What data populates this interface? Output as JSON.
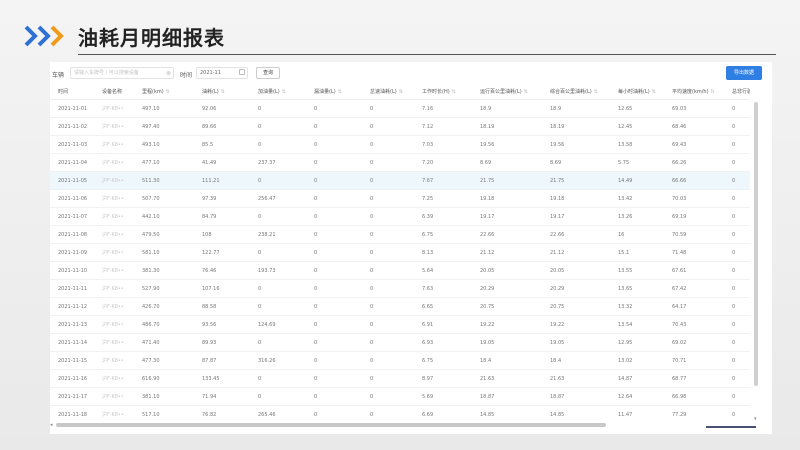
{
  "page": {
    "title": "油耗月明细报表"
  },
  "toolbar": {
    "vehicle_label": "车辆",
    "vehicle_placeholder": "请输入车牌号 / 可以搜索设备",
    "time_label": "时间",
    "time_value": "2021-11",
    "query_label": "查询",
    "export_label": "导出数据"
  },
  "colors": {
    "accent": "#2f7ee3",
    "chevron_blue": "#2f6fd6",
    "chevron_orange": "#f29a1b",
    "row_highlight": "#eef7fb"
  },
  "icons": {
    "sort": "sort-icon",
    "calendar": "calendar-icon",
    "clear": "clear-icon",
    "chevrons": "chevron-right-icon"
  },
  "table": {
    "headers": [
      "时间",
      "设备名称",
      "里程(km)",
      "油耗(L)",
      "加油量(L)",
      "漏油量(L)",
      "怠速油耗(L)",
      "工作时长(H)",
      "运行百公里油耗(L)",
      "综合百公里油耗(L)",
      "每小时油耗(L)",
      "平均速度(km/h)",
      "总非行驶油"
    ],
    "sortable": [
      false,
      false,
      true,
      true,
      true,
      true,
      true,
      true,
      true,
      true,
      true,
      true,
      false
    ],
    "rows": [
      [
        "2021-11-01",
        "沪F·K8••",
        "497.10",
        "92.06",
        "0",
        "0",
        "0",
        "7.16",
        "18.9",
        "18.9",
        "12.65",
        "69.03",
        "0"
      ],
      [
        "2021-11-02",
        "沪F·K8••",
        "497.40",
        "89.66",
        "0",
        "0",
        "0",
        "7.12",
        "18.19",
        "18.19",
        "12.45",
        "68.46",
        "0"
      ],
      [
        "2021-11-03",
        "沪F·K8••",
        "493.10",
        "85.5",
        "0",
        "0",
        "0",
        "7.03",
        "19.56",
        "19.56",
        "13.58",
        "69.43",
        "0"
      ],
      [
        "2021-11-04",
        "沪F·K8••",
        "477.10",
        "41.49",
        "237.37",
        "0",
        "0",
        "7.20",
        "8.69",
        "8.69",
        "5.75",
        "66.26",
        "0"
      ],
      [
        "2021-11-05",
        "沪F·K8••",
        "511.30",
        "111.21",
        "0",
        "0",
        "0",
        "7.67",
        "21.75",
        "21.75",
        "14.49",
        "66.66",
        "0"
      ],
      [
        "2021-11-06",
        "沪F·K8••",
        "507.70",
        "97.39",
        "256.47",
        "0",
        "0",
        "7.25",
        "19.18",
        "19.18",
        "13.42",
        "70.03",
        "0"
      ],
      [
        "2021-11-07",
        "沪F·K8••",
        "442.10",
        "84.79",
        "0",
        "0",
        "0",
        "6.39",
        "19.17",
        "19.17",
        "13.26",
        "69.19",
        "0"
      ],
      [
        "2021-11-08",
        "沪F·K8••",
        "479.50",
        "108",
        "238.21",
        "0",
        "0",
        "6.75",
        "22.66",
        "22.66",
        "16",
        "70.59",
        "0"
      ],
      [
        "2021-11-09",
        "沪F·K8••",
        "581.10",
        "122.77",
        "0",
        "0",
        "0",
        "8.13",
        "21.12",
        "21.12",
        "15.1",
        "71.48",
        "0"
      ],
      [
        "2021-11-10",
        "沪F·K8••",
        "381.30",
        "76.46",
        "193.73",
        "0",
        "0",
        "5.64",
        "20.05",
        "20.05",
        "13.55",
        "67.61",
        "0"
      ],
      [
        "2021-11-11",
        "沪F·K8••",
        "527.90",
        "107.16",
        "0",
        "0",
        "0",
        "7.63",
        "20.29",
        "20.29",
        "13.65",
        "67.42",
        "0"
      ],
      [
        "2021-11-12",
        "沪F·K8••",
        "426.70",
        "88.58",
        "0",
        "0",
        "0",
        "6.65",
        "20.75",
        "20.75",
        "13.32",
        "64.17",
        "0"
      ],
      [
        "2021-11-13",
        "沪F·K8••",
        "486.70",
        "93.56",
        "124.69",
        "0",
        "0",
        "6.91",
        "19.22",
        "19.22",
        "13.54",
        "70.43",
        "0"
      ],
      [
        "2021-11-14",
        "沪F·K8••",
        "471.40",
        "89.93",
        "0",
        "0",
        "0",
        "6.93",
        "19.05",
        "19.05",
        "12.95",
        "69.02",
        "0"
      ],
      [
        "2021-11-15",
        "沪F·K8••",
        "477.30",
        "87.87",
        "316.26",
        "0",
        "0",
        "6.75",
        "18.4",
        "18.4",
        "13.02",
        "70.71",
        "0"
      ],
      [
        "2021-11-16",
        "沪F·K8••",
        "616.90",
        "133.45",
        "0",
        "0",
        "0",
        "8.97",
        "21.63",
        "21.63",
        "14.87",
        "68.77",
        "0"
      ],
      [
        "2021-11-17",
        "沪F·K8••",
        "381.10",
        "71.94",
        "0",
        "0",
        "0",
        "5.69",
        "18.87",
        "18.87",
        "12.64",
        "66.98",
        "0"
      ],
      [
        "2021-11-18",
        "沪F·K8••",
        "517.10",
        "76.82",
        "265.46",
        "0",
        "0",
        "6.69",
        "14.85",
        "14.85",
        "11.47",
        "77.29",
        "0"
      ],
      [
        "2021-11-19",
        "沪F·K8••",
        "477.70",
        "90.4",
        "0",
        "0",
        "0",
        "6.34",
        "18.92",
        "18.92",
        "14.25",
        "75.35",
        "0"
      ]
    ],
    "highlighted_row": 4
  }
}
